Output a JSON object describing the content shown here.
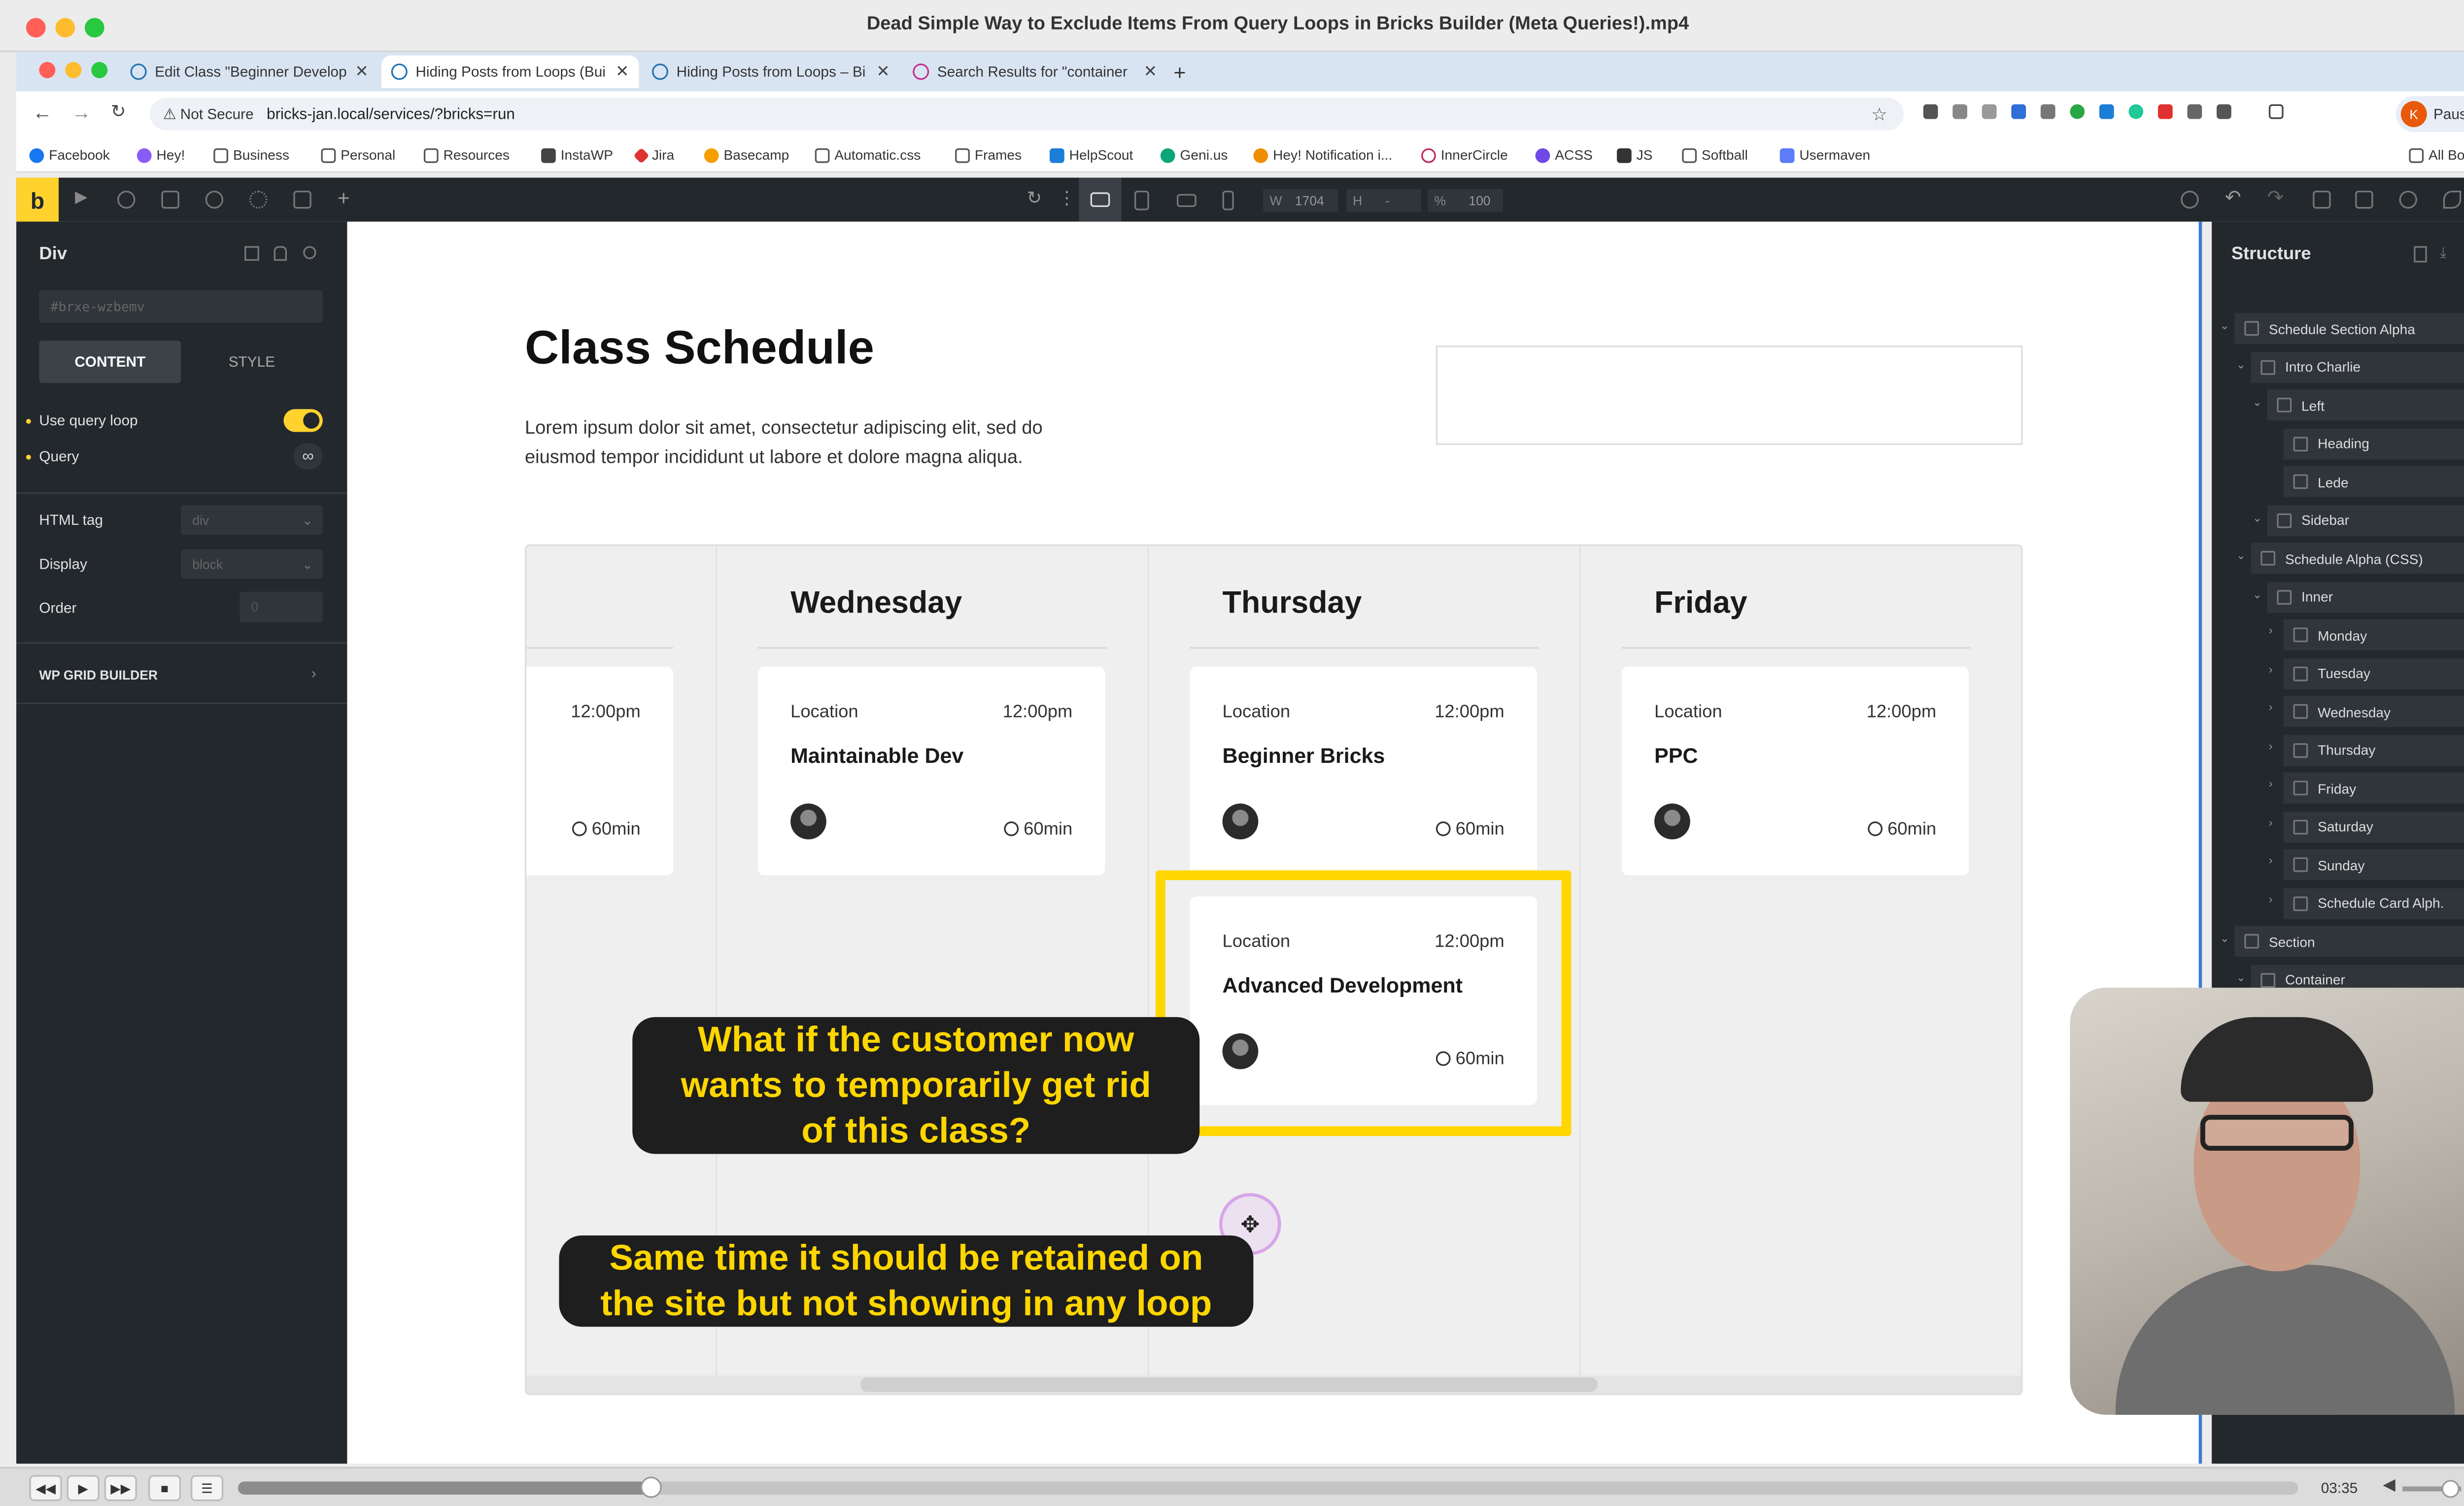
{
  "window": {
    "title": "Dead Simple Way to Exclude Items From Query Loops in Bricks Builder (Meta Queries!).mp4"
  },
  "tabs": [
    {
      "label": "Edit Class \"Beginner Develop"
    },
    {
      "label": "Hiding Posts from Loops (Bui"
    },
    {
      "label": "Hiding Posts from Loops – Bi"
    },
    {
      "label": "Search Results for \"container"
    }
  ],
  "address": {
    "security": "Not Secure",
    "url": "bricks-jan.local/services/?bricks=run",
    "profile_initial": "K",
    "profile_status": "Paused"
  },
  "bookmarks": [
    "Facebook",
    "Hey!",
    "Business",
    "Personal",
    "Resources",
    "InstaWP",
    "Jira",
    "Basecamp",
    "Automatic.css",
    "Frames",
    "HelpScout",
    "Geni.us",
    "Hey! Notification i...",
    "InnerCircle",
    "ACSS",
    "JS",
    "Softball",
    "Usermaven"
  ],
  "all_bookmarks": "All Bookmarks",
  "toolbar": {
    "width_label": "W",
    "width_value": "1704",
    "height_label": "H",
    "height_value": "-",
    "zoom_label": "%",
    "zoom_value": "100"
  },
  "left_panel": {
    "element": "Div",
    "id_placeholder": "#brxe-wzbemv",
    "tab_content": "CONTENT",
    "tab_style": "STYLE",
    "use_query_loop": "Use query loop",
    "use_query_loop_on": true,
    "query": "Query",
    "html_tag_label": "HTML tag",
    "html_tag_value": "div",
    "display_label": "Display",
    "display_value": "block",
    "order_label": "Order",
    "order_value": "0",
    "wp_grid": "WP GRID BUILDER"
  },
  "page": {
    "heading": "Class Schedule",
    "lede": "Lorem ipsum dolor sit amet, consectetur adipiscing elit, sed do eiusmod tempor incididunt ut labore et dolore magna aliqua.",
    "days": [
      "Wednesday",
      "Thursday",
      "Friday"
    ],
    "partial_card": {
      "time": "12:00pm",
      "duration": "60min"
    },
    "cards": [
      {
        "location": "Location",
        "time": "12:00pm",
        "title": "Maintainable Dev",
        "duration": "60min"
      },
      {
        "location": "Location",
        "time": "12:00pm",
        "title": "Beginner Bricks",
        "duration": "60min"
      },
      {
        "location": "Location",
        "time": "12:00pm",
        "title": "PPC",
        "duration": "60min"
      },
      {
        "location": "Location",
        "time": "12:00pm",
        "title": "Advanced Development",
        "duration": "60min"
      }
    ],
    "highlight_color": "#ffd600"
  },
  "captions": [
    "What if the customer now wants to temporarily get rid of this class?",
    "Same time it should be retained on the site but not showing in any loop"
  ],
  "caption_lines": {
    "first": [
      "What if the customer now",
      "wants to temporarily get rid",
      "of this class?"
    ],
    "second": [
      "Same time it should be retained on",
      "the site but not showing in any loop"
    ]
  },
  "structure": {
    "title": "Structure",
    "items": [
      {
        "label": "Schedule Section Alpha",
        "depth": 0
      },
      {
        "label": "Intro Charlie",
        "depth": 1
      },
      {
        "label": "Left",
        "depth": 2
      },
      {
        "label": "Heading",
        "depth": 3
      },
      {
        "label": "Lede",
        "depth": 3
      },
      {
        "label": "Sidebar",
        "depth": 2
      },
      {
        "label": "Schedule Alpha (CSS)",
        "depth": 1
      },
      {
        "label": "Inner",
        "depth": 2
      },
      {
        "label": "Monday",
        "depth": 3
      },
      {
        "label": "Tuesday",
        "depth": 3
      },
      {
        "label": "Wednesday",
        "depth": 3
      },
      {
        "label": "Thursday",
        "depth": 3
      },
      {
        "label": "Friday",
        "depth": 3
      },
      {
        "label": "Saturday",
        "depth": 3
      },
      {
        "label": "Sunday",
        "depth": 3
      },
      {
        "label": "Schedule Card Alph.",
        "depth": 3
      },
      {
        "label": "Section",
        "depth": 0
      },
      {
        "label": "Container",
        "depth": 1
      }
    ]
  },
  "player": {
    "time": "03:35",
    "progress": 0.2
  }
}
